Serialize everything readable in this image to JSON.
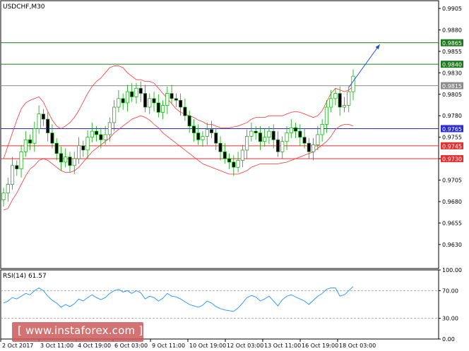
{
  "chart_data": [
    {
      "type": "line",
      "title": "USDCHF,M30",
      "series": [
        {
          "name": "",
          "color": "#00aa00",
          "note": "price (OHLC candles)",
          "y": [
            0.969,
            0.97,
            0.9722,
            0.9718,
            0.9738,
            0.9752,
            0.9748,
            0.9765,
            0.9782,
            0.9776,
            0.976,
            0.9748,
            0.9736,
            0.9726,
            0.9732,
            0.9722,
            0.973,
            0.9745,
            0.974,
            0.9755,
            0.9762,
            0.9758,
            0.9752,
            0.9758,
            0.9772,
            0.979,
            0.98,
            0.9795,
            0.9808,
            0.9802,
            0.9812,
            0.9806,
            0.979,
            0.98,
            0.9795,
            0.9784,
            0.9792,
            0.9806,
            0.98,
            0.9798,
            0.979,
            0.978,
            0.9768,
            0.976,
            0.9752,
            0.9756,
            0.9764,
            0.976,
            0.9748,
            0.9738,
            0.973,
            0.9726,
            0.972,
            0.9728,
            0.974,
            0.9756,
            0.9762,
            0.976,
            0.975,
            0.9755,
            0.9762,
            0.9752,
            0.9738,
            0.975,
            0.976,
            0.9766,
            0.9762,
            0.9755,
            0.9748,
            0.9738,
            0.9746,
            0.9758,
            0.977,
            0.979,
            0.98,
            0.9806,
            0.979,
            0.9792,
            0.9808,
            0.9826
          ]
        },
        {
          "name": "",
          "color": "#ff3333",
          "note": "Bollinger upper",
          "y": [
            0.973,
            0.9745,
            0.976,
            0.9775,
            0.9788,
            0.9795,
            0.9798,
            0.98,
            0.9802,
            0.9796,
            0.9785,
            0.9775,
            0.9768,
            0.9765,
            0.9768,
            0.9772,
            0.9778,
            0.9786,
            0.9796,
            0.9806,
            0.9814,
            0.982,
            0.9824,
            0.983,
            0.9836,
            0.9838,
            0.9838,
            0.9836,
            0.983,
            0.9826,
            0.9822,
            0.9822,
            0.982,
            0.982,
            0.9818,
            0.9812,
            0.9806,
            0.98,
            0.9794,
            0.9788,
            0.9784,
            0.9782,
            0.978,
            0.9778,
            0.9775,
            0.9773,
            0.977,
            0.977,
            0.9768,
            0.9766,
            0.9766,
            0.9766,
            0.9767,
            0.9768,
            0.977,
            0.9772,
            0.9776,
            0.9778,
            0.9778,
            0.9778,
            0.978,
            0.978,
            0.978,
            0.978,
            0.9782,
            0.9784,
            0.9785,
            0.9784,
            0.9782,
            0.978,
            0.9778,
            0.978,
            0.9786,
            0.9796,
            0.9806,
            0.9812,
            0.981,
            0.9808,
            0.981,
            0.9814
          ]
        },
        {
          "name": "",
          "color": "#ff3333",
          "note": "Bollinger lower",
          "y": [
            0.967,
            0.9672,
            0.9682,
            0.969,
            0.97,
            0.971,
            0.9718,
            0.9722,
            0.9728,
            0.973,
            0.9728,
            0.9724,
            0.972,
            0.9716,
            0.9714,
            0.9714,
            0.9716,
            0.972,
            0.9726,
            0.9732,
            0.9738,
            0.9742,
            0.9746,
            0.975,
            0.9754,
            0.976,
            0.9764,
            0.9768,
            0.9772,
            0.9776,
            0.9778,
            0.978,
            0.9778,
            0.9775,
            0.977,
            0.9766,
            0.976,
            0.9756,
            0.9752,
            0.9748,
            0.9744,
            0.974,
            0.9736,
            0.9732,
            0.9728,
            0.9724,
            0.9722,
            0.972,
            0.9718,
            0.9716,
            0.9714,
            0.9712,
            0.9712,
            0.9712,
            0.9714,
            0.9716,
            0.972,
            0.9722,
            0.9724,
            0.9724,
            0.9724,
            0.9724,
            0.9724,
            0.9725,
            0.9726,
            0.9728,
            0.973,
            0.9732,
            0.9734,
            0.9736,
            0.9738,
            0.9742,
            0.9746,
            0.975,
            0.9756,
            0.9764,
            0.9768,
            0.977,
            0.977,
            0.9768
          ]
        }
      ],
      "x_ticks": [
        "2 Oct 2017",
        "3 Oct 11:00",
        "4 Oct 19:00",
        "6 Oct 03:00",
        "9 Oct 11:00",
        "10 Oct 19:00",
        "12 Oct 03:00",
        "13 Oct 11:00",
        "16 Oct 19:00",
        "18 Oct 03:00"
      ],
      "y_ticks": [
        "0.9905",
        "0.9880",
        "0.9855",
        "0.9830",
        "0.9805",
        "0.9780",
        "0.9755",
        "0.9730",
        "0.9705",
        "0.9680",
        "0.9655",
        "0.9630"
      ],
      "ylim": [
        0.9602,
        0.9914
      ],
      "grid": false,
      "levels": [
        {
          "value": 0.9865,
          "label": "0.9865",
          "color": "#1e7a1e"
        },
        {
          "value": 0.984,
          "label": "0.9840",
          "color": "#1e7a1e"
        },
        {
          "value": 0.9815,
          "label": "0.9815",
          "color": "#8c8c8c"
        },
        {
          "value": 0.9765,
          "label": "0.9765",
          "color": "#2a2ad8"
        },
        {
          "value": 0.9745,
          "label": "0.9745",
          "color": "#e03030"
        },
        {
          "value": 0.973,
          "label": "0.9730",
          "color": "#e03030"
        }
      ],
      "arrow": {
        "from": [
          78,
          0.9813
        ],
        "to": [
          85,
          0.9863
        ],
        "color": "#1a4fd8"
      }
    },
    {
      "type": "line",
      "title": "RSI(14) 61.57",
      "series": [
        {
          "name": "",
          "color": "#1e90ff",
          "y": [
            52,
            55,
            60,
            58,
            62,
            66,
            64,
            70,
            74,
            70,
            62,
            56,
            52,
            46,
            50,
            47,
            51,
            58,
            55,
            60,
            64,
            60,
            57,
            60,
            66,
            70,
            72,
            68,
            70,
            66,
            70,
            67,
            58,
            62,
            60,
            55,
            59,
            66,
            62,
            61,
            58,
            54,
            50,
            48,
            46,
            49,
            55,
            52,
            47,
            44,
            42,
            41,
            40,
            45,
            52,
            60,
            63,
            61,
            55,
            58,
            62,
            55,
            48,
            57,
            62,
            64,
            61,
            58,
            55,
            50,
            56,
            62,
            66,
            72,
            74,
            74,
            62,
            64,
            70,
            76
          ]
        }
      ],
      "x_ticks": [],
      "y_ticks": [
        "100.00",
        "70.00",
        "30.00",
        "0.00"
      ],
      "ylim": [
        0,
        100
      ],
      "levels": [
        {
          "value": 70,
          "label": ""
        },
        {
          "value": 30,
          "label": ""
        }
      ]
    }
  ],
  "watermark": {
    "text": "[ www.instaforex.com ]"
  }
}
